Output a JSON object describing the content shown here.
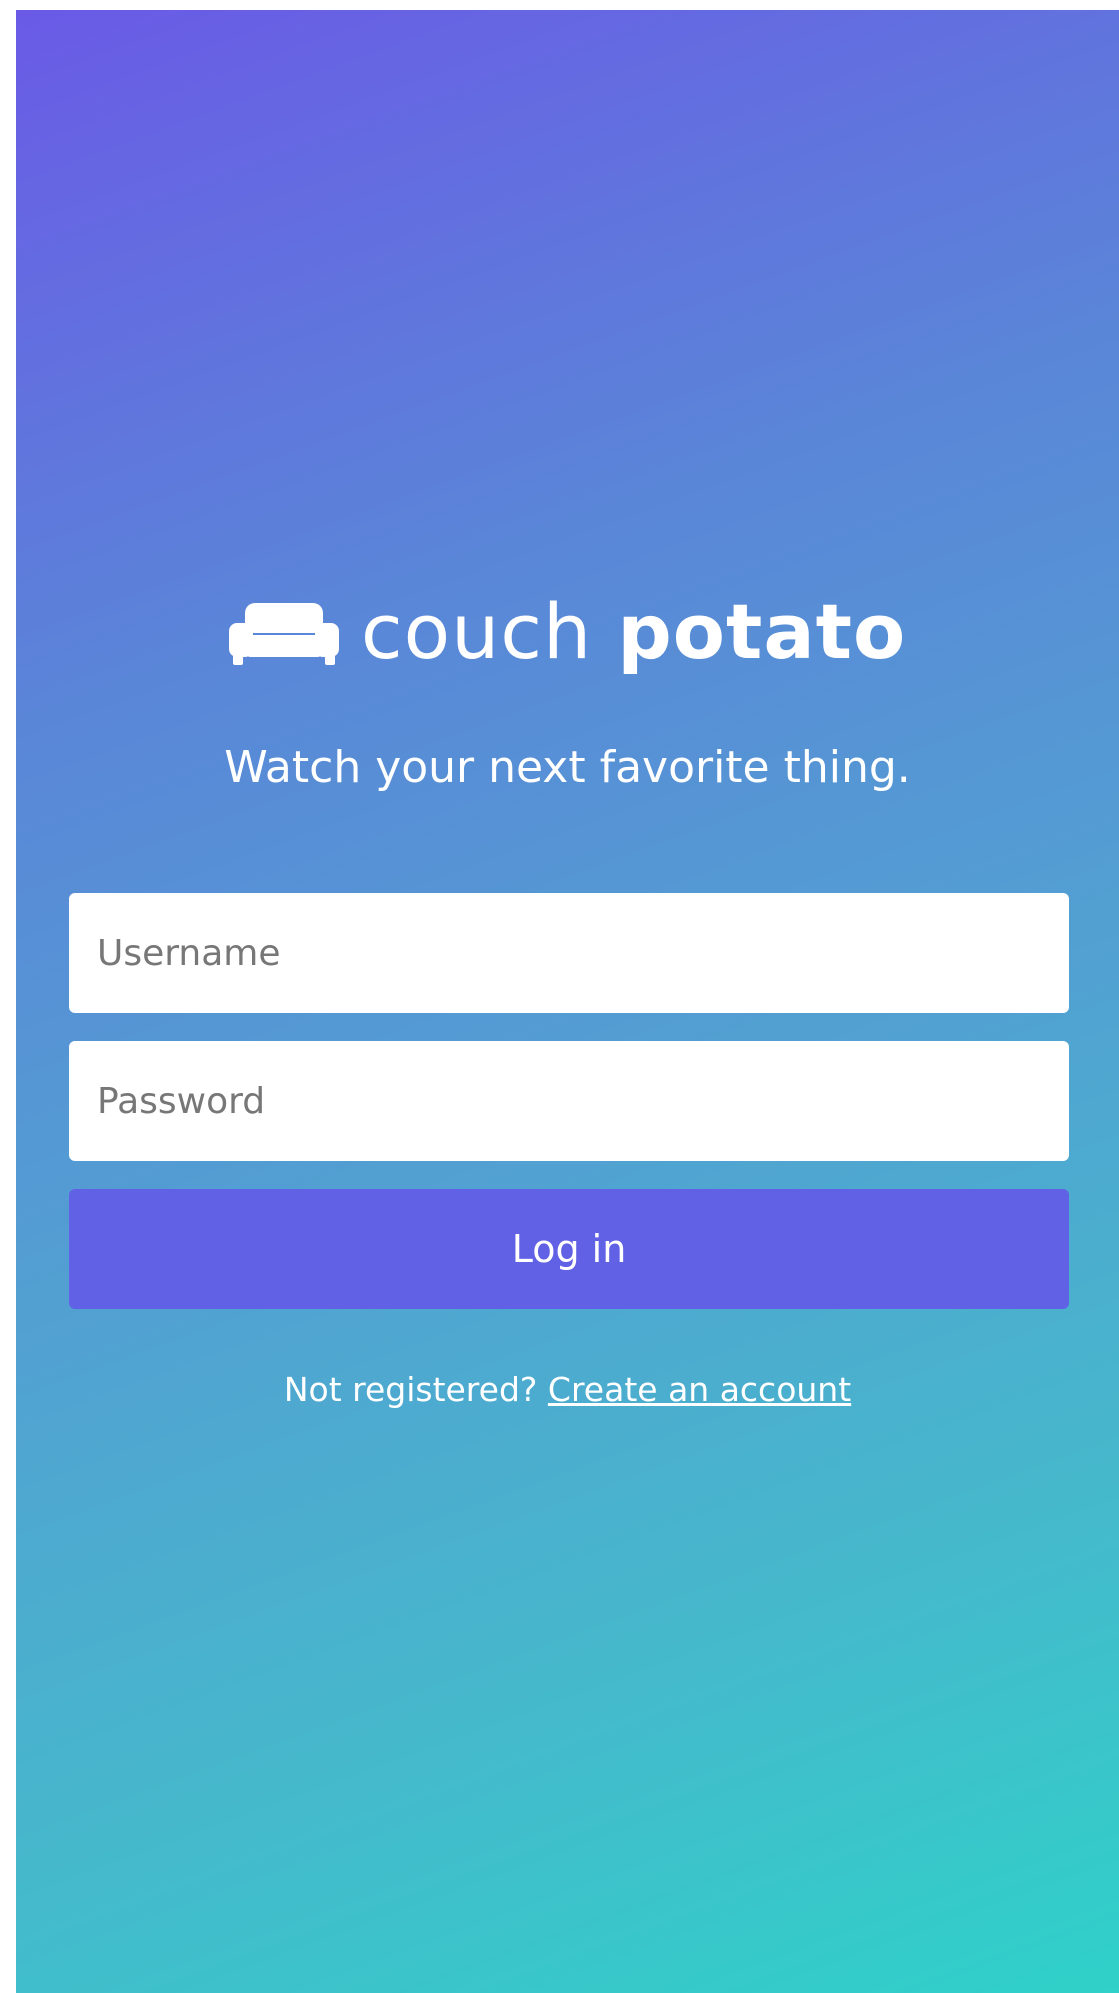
{
  "brand": {
    "name_light": "couch",
    "name_bold": "potato",
    "icon": "couch-icon"
  },
  "tagline": "Watch your next favorite thing.",
  "form": {
    "username_placeholder": "Username",
    "password_placeholder": "Password",
    "login_label": "Log in"
  },
  "register": {
    "prompt": "Not registered?",
    "link_label": "Create an account"
  },
  "colors": {
    "gradient_start": "#6a5ae6",
    "gradient_end": "#2fd1c9",
    "button": "#6161e6",
    "text_on_bg": "#ffffff"
  }
}
